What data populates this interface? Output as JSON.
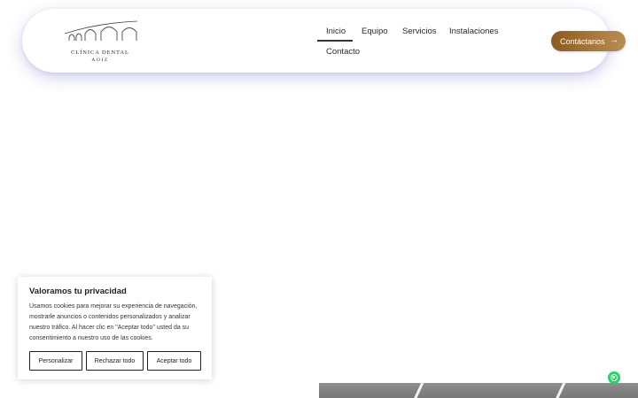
{
  "header": {
    "logo": {
      "name": "CLÍNICA DENTAL",
      "sub": "AOIZ",
      "icon": "arches-logo-icon"
    },
    "nav": [
      {
        "label": "Inicio",
        "active": true
      },
      {
        "label": "Equipo"
      },
      {
        "label": "Servicios"
      },
      {
        "label": "Instalaciones"
      },
      {
        "label": "Contacto"
      }
    ],
    "cta": {
      "label": "Contáctanos",
      "icon": "arrow-right-icon"
    }
  },
  "cookie_banner": {
    "title": "Valoramos tu privacidad",
    "text": "Usamos cookies para mejorar su experiencia de navegación, mostrarle anuncios o contenidos personalizados y analizar nuestro tráfico. Al hacer clic en \"Aceptar todo\" usted da su consentimiento a nuestro uso de las cookies.",
    "buttons": {
      "customize": "Personalizar",
      "reject": "Rechazar todo",
      "accept": "Aceptar todo"
    }
  },
  "floating": {
    "whatsapp_icon": "whatsapp-icon"
  },
  "colors": {
    "accent": "#9a6a30",
    "whatsapp": "#25d366"
  }
}
